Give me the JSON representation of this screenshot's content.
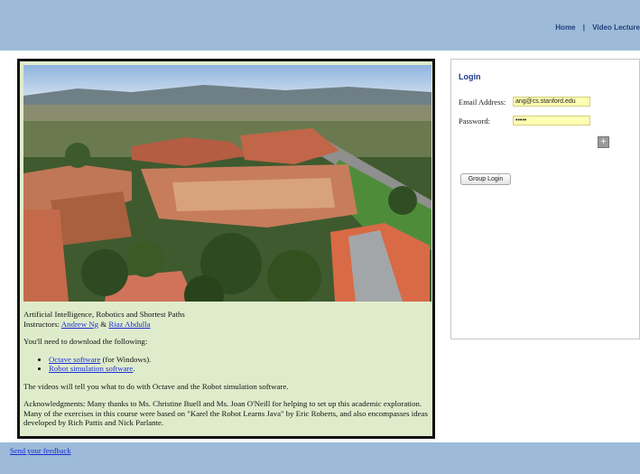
{
  "nav": {
    "home": "Home",
    "sep": "|",
    "video_lectures": "Video Lecture"
  },
  "course": {
    "title": "Artificial Intelligence, Robotics and Shortest Paths",
    "instructors_label": "Instructors:",
    "instructor_1": "Andrew Ng",
    "amp": "&",
    "instructor_2": "Riaz Abdulla",
    "download_intro": "You'll need to download the following:",
    "downloads": [
      {
        "link": "Octave software",
        "suffix": " (for Windows)."
      },
      {
        "link": "Robot simulation software",
        "suffix": "."
      }
    ],
    "videos_note": "The videos will tell you what to do with Octave and the Robot simulation software.",
    "acknowledgments": "Acknowledgments: Many thanks to Ms. Christine Buell and Ms. Joan O'Neill for helping to set up this academic exploration. Many of the exercises in this course were based on \"Karel the Robot Learns Java\" by Eric Roberts, and also encompasses ideas developed by Rich Pattis and Nick Parlante."
  },
  "login": {
    "title": "Login",
    "email_label": "Email Address:",
    "email_value": "ang@cs.stanford.edu",
    "password_label": "Password:",
    "password_value": "•••••",
    "add_icon": "+",
    "group_login": "Group Login"
  },
  "footer": {
    "feedback": "Send your feedback"
  },
  "colors": {
    "bar": "#9dbbd8",
    "panel_bg": "#dfeccb",
    "input_bg": "#ffffb3",
    "link": "#1a2fd8"
  }
}
